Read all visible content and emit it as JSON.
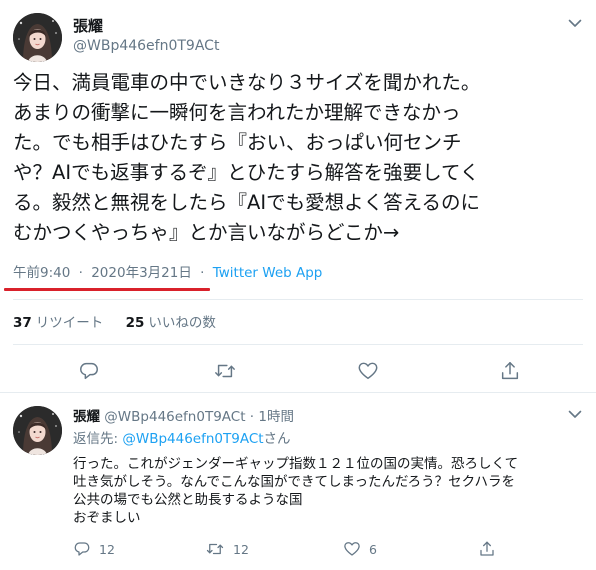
{
  "main_tweet": {
    "author_name": "張耀",
    "author_handle": "@WBp446efn0T9ACt",
    "text": "今日、満員電車の中でいきなり３サイズを聞かれた。\nあまりの衝撃に一瞬何を言われたか理解できなかっ\nた。でも相手はひたすら『おい、おっぱい何センチ\nや？AIでも返事するぞ』とひたすら解答を強要してく\nる。毅然と無視をしたら『AIでも愛想よく答えるのに\nむかつくやっちゃ』とか言いながらどこか→",
    "time": "午前9:40",
    "separator": "·",
    "date": "2020年3月21日",
    "source": "Twitter Web App",
    "retweets_count": "37",
    "retweets_label": "リツイート",
    "likes_count": "25",
    "likes_label": "いいねの数"
  },
  "reply_tweet": {
    "author_name": "張耀",
    "author_handle": "@WBp446efn0T9ACt",
    "separator": "·",
    "time_ago": "1時間",
    "reply_prefix": "返信先: ",
    "reply_to_handle": "@WBp446efn0T9ACt",
    "reply_suffix": "さん",
    "text": "行った。これがジェンダーギャップ指数１２１位の国の実情。恐ろしくて\n吐き気がしそう。なんでこんな国ができてしまったんだろう？セクハラを\n公共の場でも公然と助長するような国\nおぞましい",
    "reply_count": "12",
    "retweet_count": "12",
    "like_count": "6"
  },
  "icons": {
    "caret": "chevron-down-icon",
    "reply": "reply-icon",
    "retweet": "retweet-icon",
    "like": "heart-icon",
    "share": "share-icon"
  },
  "colors": {
    "text": "#14171a",
    "secondary": "#657786",
    "link": "#1da1f2",
    "divider": "#e6ecf0",
    "highlight_underline": "#d9212b"
  }
}
